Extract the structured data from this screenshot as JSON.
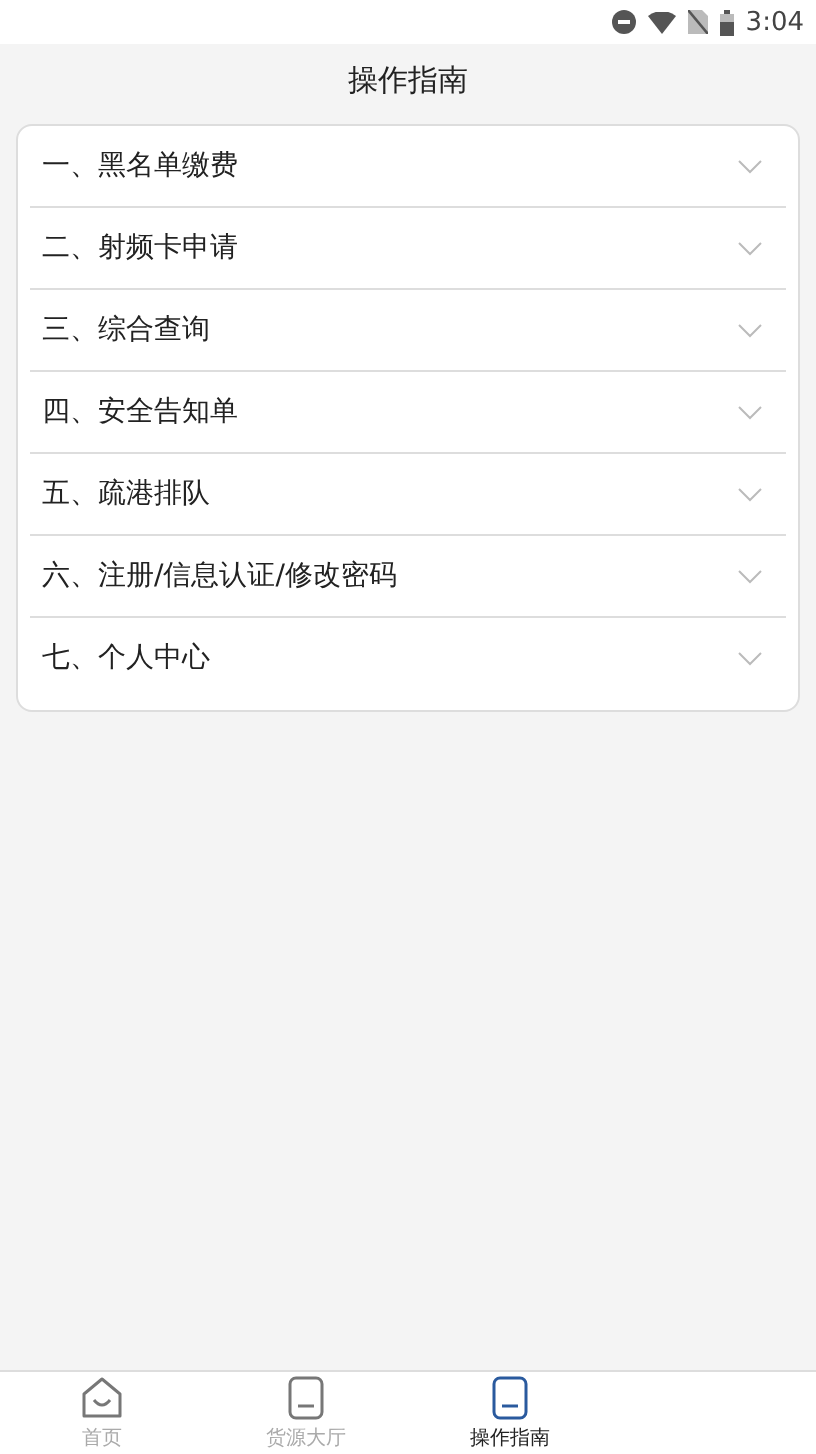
{
  "status_bar": {
    "time": "3:04"
  },
  "header": {
    "title": "操作指南"
  },
  "guide_items": [
    {
      "label": "一、黑名单缴费",
      "expanded": false
    },
    {
      "label": "二、射频卡申请",
      "expanded": false
    },
    {
      "label": "三、综合查询",
      "expanded": false
    },
    {
      "label": "四、安全告知单",
      "expanded": false
    },
    {
      "label": "五、疏港排队",
      "expanded": false
    },
    {
      "label": "六、注册/信息认证/修改密码",
      "expanded": false
    },
    {
      "label": "七、个人中心",
      "expanded": false
    }
  ],
  "tab_bar": [
    {
      "label": "首页",
      "kind": "home",
      "selected": false
    },
    {
      "label": "货源大厅",
      "kind": "doc",
      "selected": false
    },
    {
      "label": "操作指南",
      "kind": "doc",
      "selected": true
    }
  ]
}
